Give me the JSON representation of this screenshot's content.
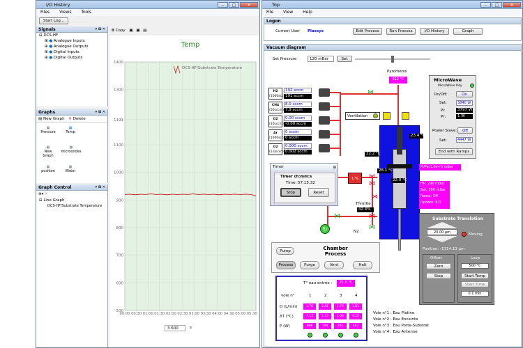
{
  "io_history": {
    "title": "I/O History",
    "menu": [
      "Files",
      "Views",
      "Tools"
    ],
    "start_log": "Start Log...",
    "signals": {
      "header": "Signals",
      "root": "DCS-HF",
      "children": [
        "Analogue Inputs",
        "Analogue Outputs",
        "Digital Inputs",
        "Digital Outputs"
      ]
    },
    "graphs": {
      "header": "Graphs",
      "new_graph": "New Graph",
      "delete": "Delete",
      "items": [
        "Pressure",
        "Temp",
        "New Graph",
        "microondes",
        "position",
        "Water"
      ]
    },
    "graph_control": {
      "header": "Graph Control",
      "items": [
        "Line Graph",
        "DCS-HF/Substrate Temperature"
      ]
    },
    "toolbar": {
      "copy": "Copy"
    },
    "chart_value": "3 600",
    "chart_unit": "s"
  },
  "chart_data": {
    "type": "line",
    "title": "Temp",
    "ylim": [
      500,
      1400
    ],
    "yticks": [
      "1400",
      "1300",
      "1191",
      "1100",
      "1000",
      "900",
      "800",
      "700",
      "600",
      "500"
    ],
    "xticks": [
      "00:00",
      "00:30",
      "01:00",
      "01:30",
      "02:00",
      "02:30",
      "03:00",
      "03:30",
      "04:00",
      "04:30",
      "05:00",
      "05:30"
    ],
    "series": [
      {
        "name": "DCS-HF/Substrate Temperature",
        "color": "#c00000",
        "values": [
          920,
          921,
          919,
          921,
          920,
          922,
          920,
          921,
          919,
          921,
          920,
          921,
          920,
          922,
          920,
          921,
          920,
          921,
          919,
          921,
          920,
          921,
          920,
          921,
          920,
          915
        ]
      }
    ]
  },
  "top": {
    "title": "Top",
    "menu": [
      "File",
      "View",
      "Help"
    ],
    "logon": {
      "header": "Logon",
      "current_user_label": "Current User",
      "current_user": "Plassys",
      "buttons": [
        "Edit Process",
        "Run Process",
        "I/O History",
        "Graph"
      ]
    },
    "vacuum": {
      "header": "Vacuum diagram",
      "set_pressure_label": "Set Pressure",
      "set_pressure_value": "120 mBar",
      "set": "Set"
    },
    "pyrometre": {
      "label": "Pyromètre",
      "value": "912 °C"
    },
    "gases": [
      {
        "name": "H2",
        "range": "(1000sccm)",
        "set": "192 sccm",
        "read": "191 sccm"
      },
      {
        "name": "CH4",
        "range": "(50sccm)",
        "set": "8.0 sccm",
        "read": "7.9 sccm"
      },
      {
        "name": "O2",
        "range": "(10sccm)",
        "set": "0.00 sccm",
        "read": "-0.00 sccm"
      },
      {
        "name": "Ar",
        "range": "(1000sccm)",
        "set": "0 sccm",
        "read": "0 sccm"
      },
      {
        "name": "O2",
        "range": "(5.0sccm)",
        "set": "0.000 sccm",
        "read": "0.002 sccm"
      }
    ],
    "ventilation": "Ventilation",
    "temps": [
      "23.4 °C",
      "22.2 °C",
      "28.1 °C",
      "22.0 °C"
    ],
    "microwave": {
      "title": "MicroWave",
      "rdy": "MicroWave Rdy",
      "onoff_label": "On/Off:",
      "onoff": "On",
      "set_label": "Set:",
      "set": "3840 W",
      "pi_label": "Pi:",
      "pi": "3797 W",
      "pr_label": "Pr:",
      "pr": "1 W",
      "slave_label": "Power Slave:",
      "slave": "Off",
      "set2_label": "Set:",
      "set2": "4447 W",
      "end_ramps": "End with Ramps"
    },
    "pressure": {
      "pipe": "Pi/Pe:1.0e+3 mBar",
      "hp": "HP: 290 mBar",
      "set": "Set: 290 mBar",
      "ramp": "Ramp: Off",
      "update": "Update: 6:0"
    },
    "timer": {
      "title": "Timer",
      "label": "Timer (h:mm:s",
      "time": "Time: 57:15:32",
      "stop": "Stop",
      "reset": "Reset"
    },
    "valve_pct": "1 %",
    "throttle": {
      "label": "Throttle",
      "value": "42.4%"
    },
    "n2": "N2",
    "chamber": {
      "title": "Chamber Process",
      "buttons": [
        "Pump",
        "Process",
        "Purge",
        "Vent",
        "Halt"
      ]
    },
    "translation": {
      "title": "Substrate Translation",
      "step": "20.00 µm",
      "moving": "Moving",
      "position": "Position: -1114.13 µm",
      "offset": "Offset",
      "loop": "Loop",
      "zero": "Zero",
      "stop": "Stop",
      "loop_val": "500 °C",
      "start_temp": "Start Temp",
      "start_time": "Start Time",
      "time_val": "0.1 min"
    },
    "water": {
      "inlet_label": "T° eau entrée :",
      "inlet": "21.0 °C",
      "headers": [
        "1",
        "2",
        "3",
        "4"
      ],
      "voie": "voie n°",
      "rows": [
        {
          "label": "D (L/min)",
          "values": [
            "1.78",
            "2.41",
            "1.76",
            "1.61"
          ]
        },
        {
          "label": "ΔT (°C)",
          "values": [
            "7.13",
            "1.15",
            "1.04",
            "4.22"
          ]
        },
        {
          "label": "P (W)",
          "values": [
            "888",
            "194",
            "301",
            "467"
          ]
        }
      ],
      "notes": [
        "Voie n°1 : Eau Platine",
        "Voie n°2 : Eau Enceinte",
        "Voie n°3 : Eau Porte-Substrat",
        "Voie n°4 : Eau Antenne"
      ]
    }
  },
  "colors": {
    "magenta": "#ff00ff",
    "chamber": "#1010e0",
    "pipe": "#e03030"
  }
}
